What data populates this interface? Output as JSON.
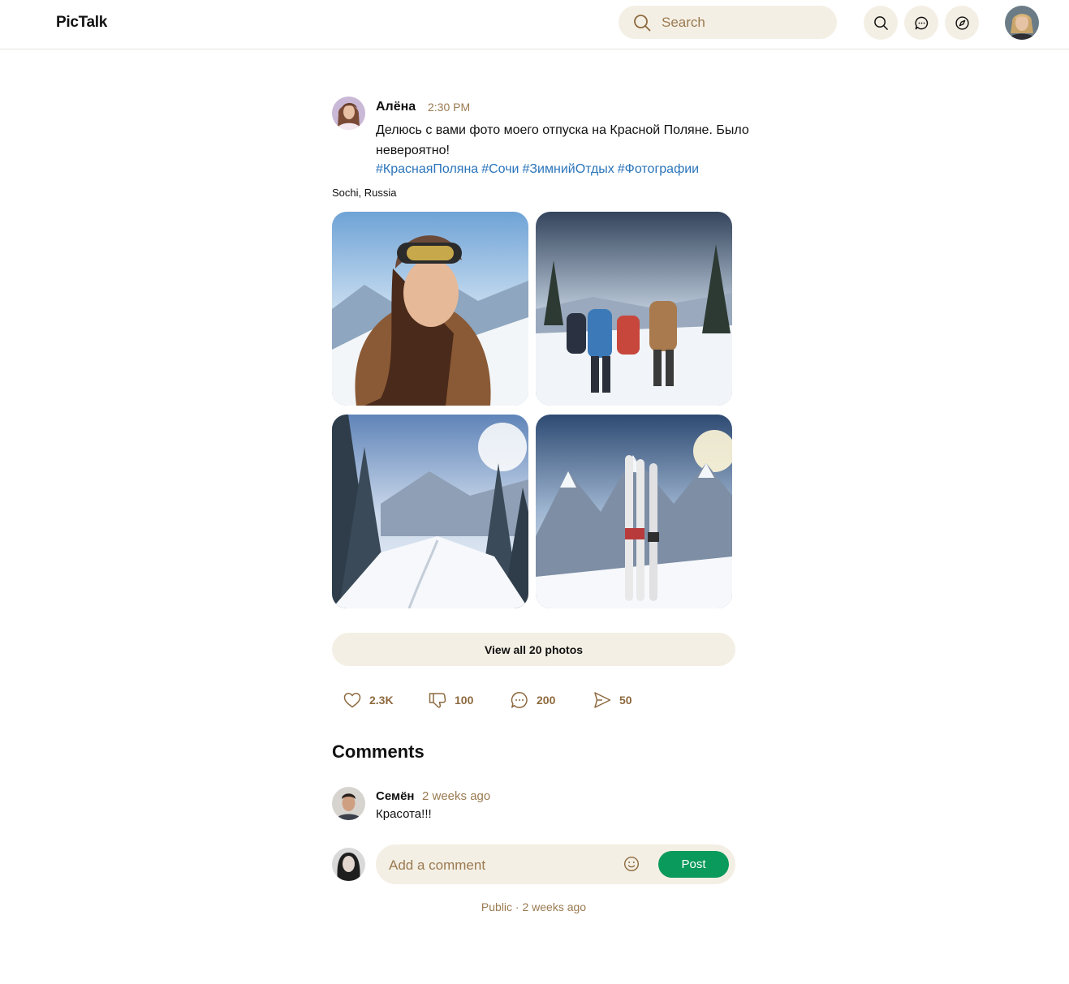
{
  "app": {
    "name": "PicTalk"
  },
  "header": {
    "search_placeholder": "Search",
    "buttons": {
      "search": "search-icon",
      "messages": "chat-icon",
      "explore": "compass-icon"
    }
  },
  "post": {
    "author": "Алёна",
    "time": "2:30 PM",
    "text": "Делюсь с вами фото моего отпуска на Красной Поляне. Было невероятно!",
    "hashtags": [
      "#КраснаяПоляна",
      "#Сочи",
      "#ЗимнийОтдых",
      "#Фотографии"
    ],
    "location": "Sochi, Russia",
    "photos": [
      "woman-in-ski-goggles",
      "hikers-on-snowy-trail",
      "snowy-forest-valley",
      "skis-in-snow"
    ],
    "view_all_label": "View all 20 photos",
    "actions": {
      "likes": "2.3K",
      "dislikes": "100",
      "comments": "200",
      "shares": "50"
    }
  },
  "comments_section": {
    "title": "Comments",
    "comments": [
      {
        "author": "Семён",
        "time": "2 weeks ago",
        "text": "Красота!!!"
      }
    ],
    "input_placeholder": "Add a comment",
    "post_label": "Post"
  },
  "footer": {
    "visibility": "Public",
    "separator": "·",
    "age": "2 weeks ago",
    "meta": "Public · 2 weeks ago"
  },
  "colors": {
    "accent": "#0a9a5b",
    "hashtag": "#2a74ba",
    "muted": "#9a7a52",
    "pill_bg": "#f4efe4"
  }
}
